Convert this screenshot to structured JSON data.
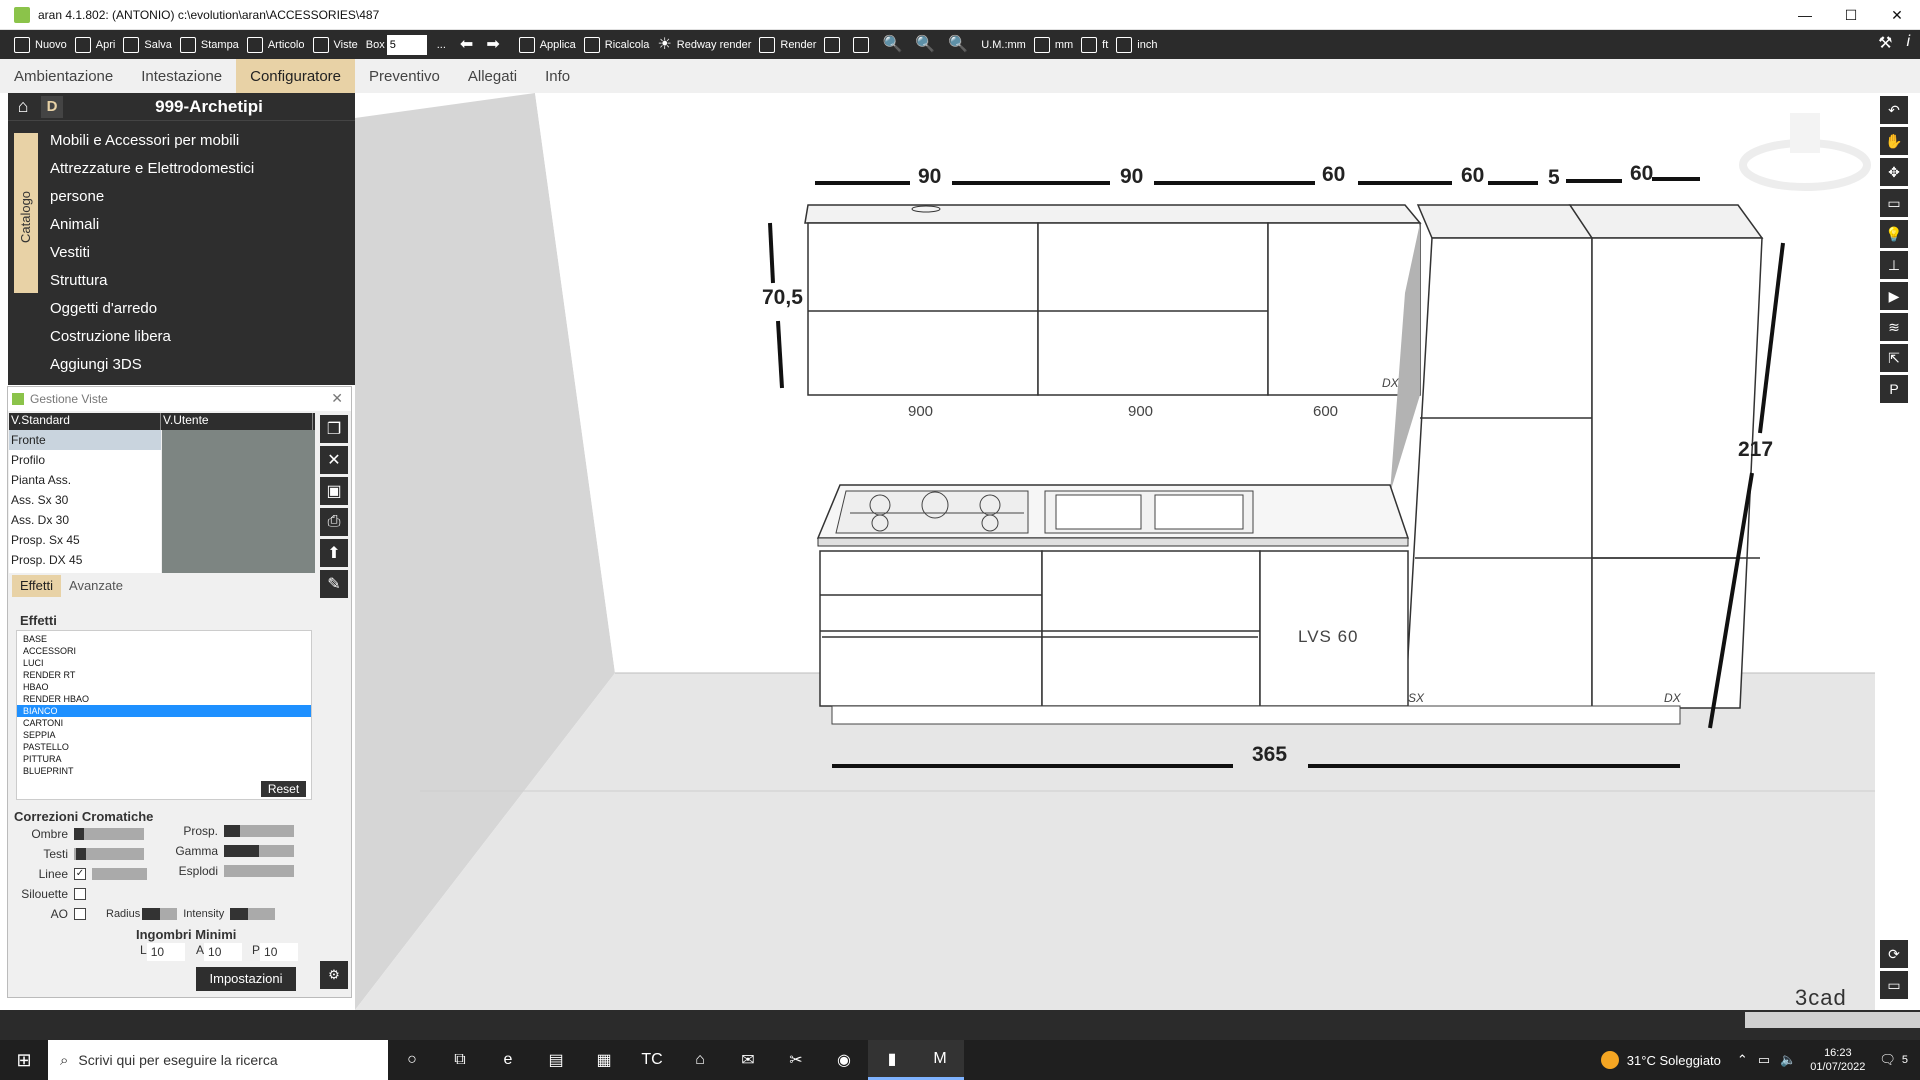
{
  "window": {
    "title": "aran 4.1.802: (ANTONIO)  c:\\evolution\\aran\\ACCESSORIES\\487",
    "controls": [
      "—",
      "☐",
      "✕"
    ]
  },
  "toolbar": {
    "nuovo": "Nuovo",
    "apri": "Apri",
    "salva": "Salva",
    "stampa": "Stampa",
    "articolo": "Articolo",
    "viste": "Viste",
    "box_label": "Box",
    "box_value": "5",
    "ellipsis": "...",
    "applica": "Applica",
    "ricalcola": "Ricalcola",
    "redway": "Redway render",
    "render": "Render",
    "um_mm": "U.M.:mm",
    "mm": "mm",
    "ft": "ft",
    "inch": "inch"
  },
  "menu": {
    "tabs": [
      "Ambientazione",
      "Intestazione",
      "Configuratore",
      "Preventivo",
      "Allegati",
      "Info"
    ],
    "active": "Configuratore"
  },
  "catalog": {
    "d_button": "D",
    "title": "999-Archetipi",
    "side_label": "Catalogo",
    "items": [
      "Mobili e Accessori per mobili",
      "Attrezzature e Elettrodomestici",
      "persone",
      "Animali",
      "Vestiti",
      "Struttura",
      "Oggetti d'arredo",
      "Costruzione libera",
      "Aggiungi 3DS"
    ]
  },
  "viste": {
    "title": "Gestione Viste",
    "col_standard": "V.Standard",
    "col_user": "V.Utente",
    "standard_views": [
      "Fronte",
      "Profilo",
      "Pianta Ass.",
      "Ass. Sx 30",
      "Ass. Dx 30",
      "Prosp. Sx 45",
      "Prosp. DX 45"
    ],
    "selected_view": "Fronte",
    "tabs": [
      "Effetti",
      "Avanzate"
    ],
    "effects_title": "Effetti",
    "effects": [
      "BASE",
      "ACCESSORI",
      "LUCI",
      "RENDER RT",
      "HBAO",
      "RENDER HBAO",
      "BIANCO",
      "CARTONI",
      "SEPPIA",
      "PASTELLO",
      "PITTURA",
      "BLUEPRINT"
    ],
    "selected_effect": "BIANCO",
    "reset": "Reset",
    "corrections_title": "Correzioni  Cromatiche",
    "sliders": {
      "ombre": "Ombre",
      "testi": "Testi",
      "linee": "Linee",
      "silouette": "Silouette",
      "ao": "AO",
      "prosp": "Prosp.",
      "gamma": "Gamma",
      "esplodi": "Esplodi",
      "radius": "Radius",
      "intensity": "Intensity"
    },
    "linee_checked": "✓",
    "ingombri_title": "Ingombri Minimi",
    "ingombri": {
      "l_label": "L",
      "l": "10",
      "a_label": "A",
      "a": "10",
      "p_label": "P",
      "p": "10"
    },
    "impostazioni": "Impostazioni"
  },
  "drawing": {
    "widths_top": [
      "90",
      "90",
      "60",
      "60",
      "5",
      "60"
    ],
    "height_wall": "70,5",
    "height_total": "217",
    "width_total": "365",
    "module_widths": [
      "900",
      "900",
      "600"
    ],
    "labels": {
      "dx": "DX",
      "sx": "SX",
      "lvs": "LVS 60"
    }
  },
  "brand": "3cad",
  "taskbar": {
    "search_placeholder": "Scrivi qui per eseguire la ricerca",
    "weather": "31°C  Soleggiato",
    "time": "16:23",
    "date": "01/07/2022",
    "notifications": "5"
  }
}
